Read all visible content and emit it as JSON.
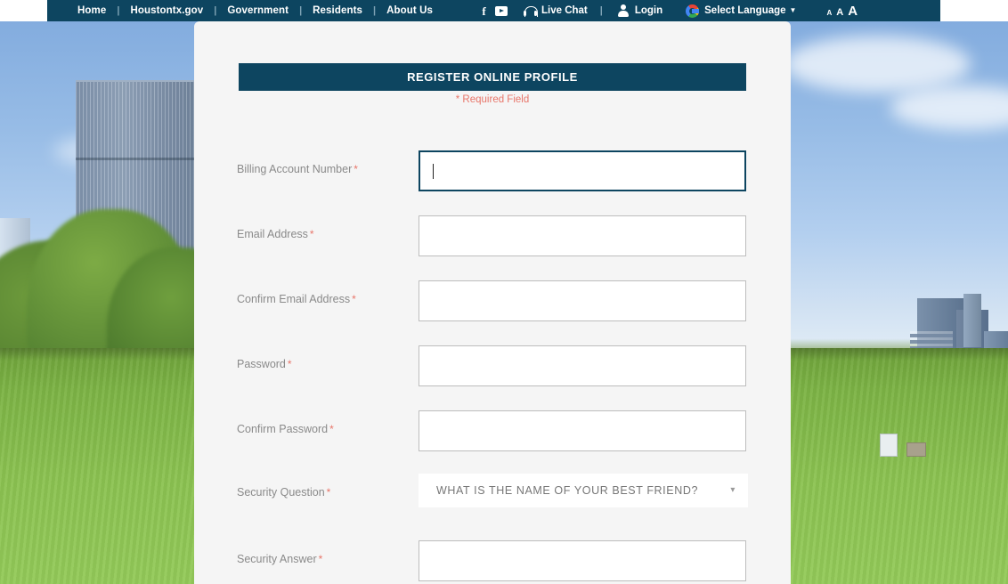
{
  "topnav": {
    "links": [
      {
        "label": "Home",
        "name": "nav-home"
      },
      {
        "label": "Houstontx.gov",
        "name": "nav-houstontx-gov"
      },
      {
        "label": "Government",
        "name": "nav-government"
      },
      {
        "label": "Residents",
        "name": "nav-residents"
      },
      {
        "label": "About Us",
        "name": "nav-about-us"
      }
    ],
    "separator": "|",
    "facebook_icon": "facebook-icon",
    "youtube_icon": "youtube-icon",
    "live_chat_label": "Live Chat",
    "live_chat_icon": "headset-icon",
    "login_label": "Login",
    "login_icon": "user-icon",
    "language_label": "Select Language",
    "language_icon": "google-translate-icon",
    "language_caret": "▼",
    "font_small": "A",
    "font_medium": "A",
    "font_large": "A",
    "bar_color": "#0d4560"
  },
  "form": {
    "title": "REGISTER ONLINE PROFILE",
    "required_note": "* Required Field",
    "required_mark": "*",
    "accent_color": "#0d4560",
    "required_color": "#e8766a",
    "fields": [
      {
        "label": "Billing Account Number",
        "name": "billing-account-number",
        "type": "text",
        "value": "",
        "placeholder": "",
        "focused": true
      },
      {
        "label": "Email Address",
        "name": "email-address",
        "type": "text",
        "value": "",
        "placeholder": "",
        "focused": false
      },
      {
        "label": "Confirm Email Address",
        "name": "confirm-email-address",
        "type": "text",
        "value": "",
        "placeholder": "",
        "focused": false
      },
      {
        "label": "Password",
        "name": "password",
        "type": "password",
        "value": "",
        "placeholder": "",
        "focused": false
      },
      {
        "label": "Confirm Password",
        "name": "confirm-password",
        "type": "password",
        "value": "",
        "placeholder": "",
        "focused": false
      },
      {
        "label": "Security Question",
        "name": "security-question",
        "type": "select",
        "value": "WHAT IS THE NAME OF YOUR BEST FRIEND?",
        "caret": "▾",
        "focused": false
      },
      {
        "label": "Security Answer",
        "name": "security-answer",
        "type": "text",
        "value": "",
        "placeholder": "",
        "focused": false
      }
    ]
  },
  "background": {
    "description": "city park with green lawn, trees and downtown skyline under blue sky"
  }
}
